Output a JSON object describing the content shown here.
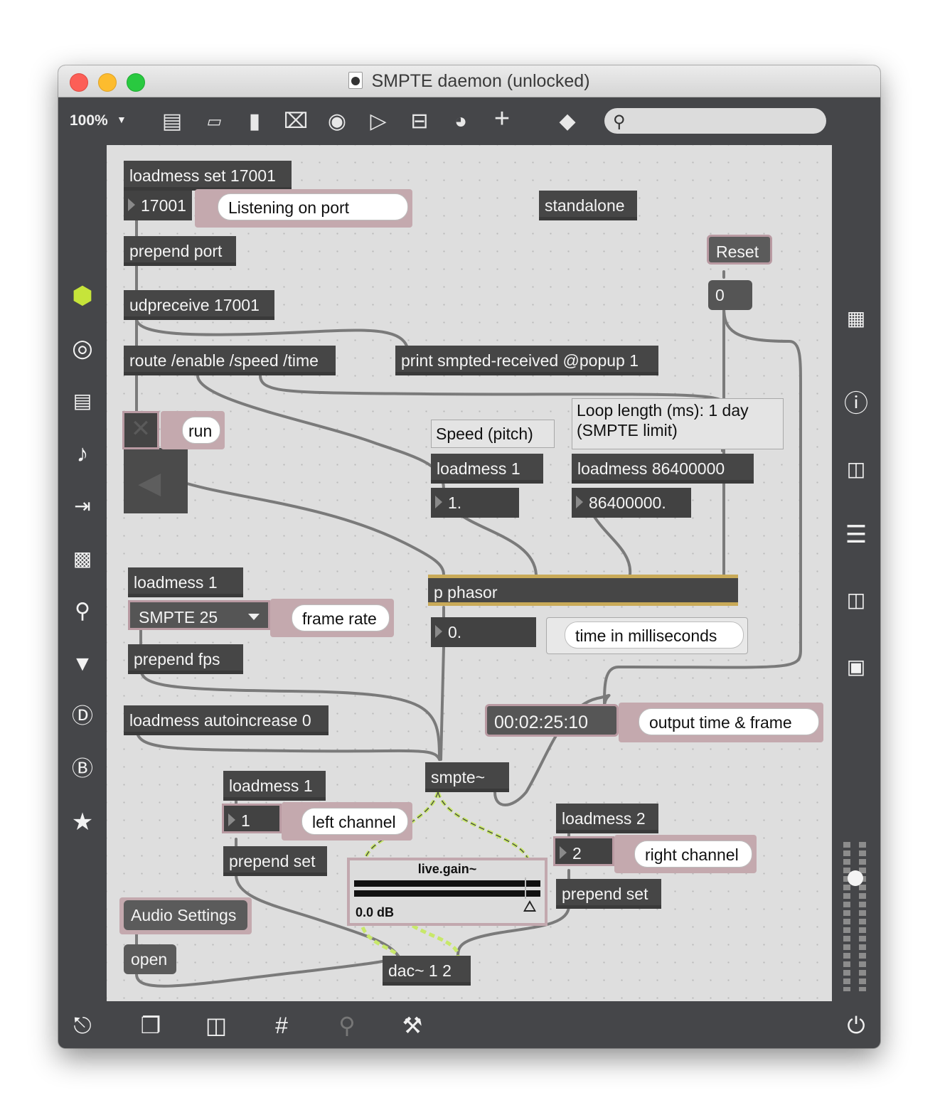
{
  "window": {
    "title": "SMPTE daemon (unlocked)"
  },
  "toolbar": {
    "zoom": "100%",
    "zoom_arrow": "▼",
    "search_placeholder": ""
  },
  "objects": {
    "loadmess_set": "loadmess set 17001",
    "port_number": "17001",
    "port_comment": "Listening on port",
    "standalone": "standalone",
    "prepend_port": "prepend port",
    "reset_msg": "Reset",
    "zero_msg": "0",
    "udpreceive": "udpreceive 17001",
    "route": "route /enable /speed /time",
    "print": "print smpted-received @popup 1",
    "run_comment": "run",
    "speed_comment": "Speed (pitch)",
    "loop_comment": "Loop length (ms): 1 day (SMPTE limit)",
    "loadmess_speed": "loadmess 1",
    "speed_value": "1.",
    "loadmess_loop": "loadmess 86400000",
    "loop_value": "86400000.",
    "loadmess_fps": "loadmess 1",
    "fps_menu": "SMPTE 25",
    "fps_comment": "frame rate",
    "phasor": "p phasor",
    "ms_value": "0.",
    "ms_comment": "time in milliseconds",
    "prepend_fps": "prepend fps",
    "autoincrease": "loadmess autoincrease 0",
    "timecode": "00:02:25:10",
    "timecode_comment": "output time & frame",
    "smpte": "smpte~",
    "loadmess_left": "loadmess 1",
    "left_value": "1",
    "left_comment": "left channel",
    "loadmess_right": "loadmess 2",
    "right_value": "2",
    "right_comment": "right channel",
    "gain_title": "live.gain~",
    "gain_db": "0.0 dB",
    "prepend_set_left": "prepend set",
    "prepend_set_right": "prepend set",
    "audio_settings": "Audio Settings",
    "open_msg": "open",
    "dac": "dac~ 1 2"
  },
  "colors": {
    "window_bg": "#454649",
    "canvas_bg": "#dedede",
    "object_bg": "#464646",
    "phasor_accent": "#c9aa58",
    "signal_cord": "#c8e86a",
    "selection_border": "#b99aa2",
    "cube_icon": "#c6e43a"
  },
  "icons": {
    "left_sidebar": [
      "package-cube-icon",
      "target-icon",
      "film-icon",
      "music-note-icon",
      "playlist-icon",
      "image-icon",
      "paperclip-icon",
      "plug-icon",
      "v-badge-icon",
      "b-badge-icon",
      "star-icon"
    ],
    "right_sidebar": [
      "grid-icon",
      "info-icon",
      "columns-icon",
      "list-icon",
      "book-icon",
      "camera-icon",
      "volume-slider-icon"
    ],
    "bottom": [
      "lock-icon",
      "windows-icon",
      "presentation-icon",
      "grid-icon",
      "clip-add-icon",
      "wrench-icon",
      "power-icon"
    ]
  }
}
